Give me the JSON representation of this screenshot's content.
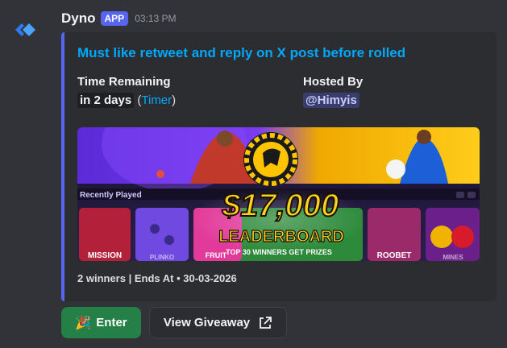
{
  "message": {
    "username": "Dyno",
    "badge": "APP",
    "timestamp": "03:13 PM"
  },
  "embed": {
    "title": "Must like retweet and reply on X post before rolled",
    "fields": [
      {
        "name": "Time Remaining",
        "value_code": "in 2 days",
        "value_open": " (",
        "value_link": "Timer",
        "value_close": ")"
      },
      {
        "name": "Hosted By",
        "value_mention": "@Himyis"
      }
    ],
    "banner": {
      "recently_played": "Recently Played",
      "amount": "$17,000",
      "subtitle": "LEADERBOARD",
      "tagline": "TOP 30 WINNERS GET PRIZES",
      "tiles": [
        "MISSION",
        "PLINKO",
        "FRUIT",
        "ROOBET",
        "MINES"
      ]
    },
    "footer": "2 winners | Ends At • 30-03-2026"
  },
  "buttons": {
    "enter_emoji": "🎉",
    "enter_label": "Enter",
    "view_label": "View Giveaway"
  },
  "colors": {
    "accent": "#5865f2",
    "link": "#00a8fc",
    "enter_button": "#248046",
    "banner_gold": "#f5c518"
  }
}
